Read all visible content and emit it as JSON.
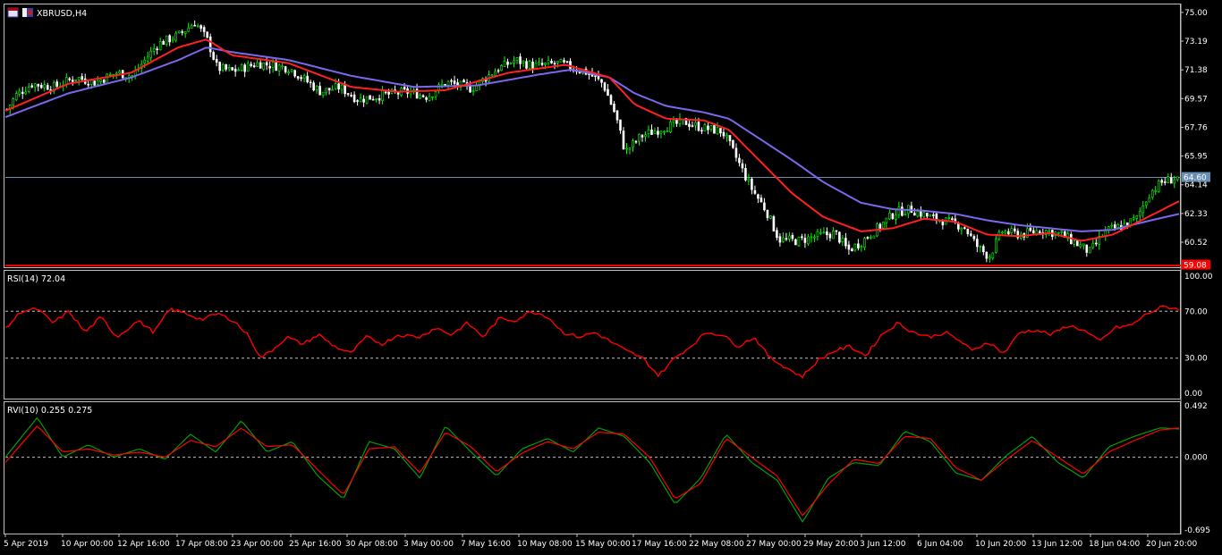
{
  "window": {
    "symbol_title": "XBRUSD,H4",
    "icon_names": [
      "chart-window-icon",
      "symbol-flag-icon"
    ]
  },
  "colors": {
    "background": "#000000",
    "frame": "#c0c0c0",
    "bull_candle": "#00ff00",
    "bear_candle": "#ffffff",
    "ma_fast": "#ff2020",
    "ma_slow": "#7b68ee",
    "bid_line": "#6a8fb5",
    "level_line": "#ff0000",
    "rsi_line": "#ff0000",
    "rvi_main": "#00a000",
    "rvi_signal": "#ff0000",
    "dashed_level": "#c0c0c0"
  },
  "chart_data": [
    {
      "type": "candlestick",
      "title": "XBRUSD,H4",
      "ylim": [
        59.0,
        75.5
      ],
      "y_ticks": [
        "75.00",
        "73.19",
        "71.38",
        "69.57",
        "67.76",
        "65.95",
        "64.14",
        "62.33",
        "60.52"
      ],
      "x_ticks": [
        "5 Apr 2019",
        "10 Apr 00:00",
        "12 Apr 16:00",
        "17 Apr 08:00",
        "23 Apr 00:00",
        "25 Apr 16:00",
        "30 Apr 08:00",
        "3 May 00:00",
        "7 May 16:00",
        "10 May 08:00",
        "15 May 00:00",
        "17 May 16:00",
        "22 May 08:00",
        "27 May 00:00",
        "29 May 20:00",
        "3 Jun 12:00",
        "6 Jun 04:00",
        "10 Jun 20:00",
        "13 Jun 12:00",
        "18 Jun 04:00",
        "20 Jun 20:00"
      ],
      "bid_label": "64.60",
      "bid_value": 64.6,
      "level_label": "59.08",
      "level_value": 59.08,
      "close_keypoints": [
        [
          0,
          68.9
        ],
        [
          3,
          69.8
        ],
        [
          8,
          70.5
        ],
        [
          15,
          70.3
        ],
        [
          22,
          70.9
        ],
        [
          28,
          70.6
        ],
        [
          35,
          71.2
        ],
        [
          40,
          71.0
        ],
        [
          48,
          73.0
        ],
        [
          55,
          73.6
        ],
        [
          60,
          74.4
        ],
        [
          64,
          73.2
        ],
        [
          67,
          71.5
        ],
        [
          72,
          71.3
        ],
        [
          80,
          71.8
        ],
        [
          90,
          71.5
        ],
        [
          100,
          70.0
        ],
        [
          106,
          70.3
        ],
        [
          112,
          69.5
        ],
        [
          120,
          69.8
        ],
        [
          128,
          70.0
        ],
        [
          134,
          69.7
        ],
        [
          140,
          70.6
        ],
        [
          148,
          70.2
        ],
        [
          156,
          71.4
        ],
        [
          162,
          72.0
        ],
        [
          168,
          71.6
        ],
        [
          176,
          71.8
        ],
        [
          185,
          71.2
        ],
        [
          190,
          70.5
        ],
        [
          194,
          68.5
        ],
        [
          197,
          66.2
        ],
        [
          202,
          67.2
        ],
        [
          210,
          67.8
        ],
        [
          216,
          68.1
        ],
        [
          222,
          67.7
        ],
        [
          228,
          67.5
        ],
        [
          232,
          66.0
        ],
        [
          237,
          64.0
        ],
        [
          242,
          62.5
        ],
        [
          246,
          60.7
        ],
        [
          252,
          60.6
        ],
        [
          258,
          60.9
        ],
        [
          264,
          61.1
        ],
        [
          268,
          60.0
        ],
        [
          272,
          60.5
        ],
        [
          278,
          61.5
        ],
        [
          283,
          62.4
        ],
        [
          288,
          62.6
        ],
        [
          294,
          62.1
        ],
        [
          300,
          61.8
        ],
        [
          305,
          61.5
        ],
        [
          309,
          60.3
        ],
        [
          313,
          59.6
        ],
        [
          317,
          61.2
        ],
        [
          323,
          61.0
        ],
        [
          330,
          61.3
        ],
        [
          336,
          61.0
        ],
        [
          342,
          60.3
        ],
        [
          345,
          59.9
        ],
        [
          350,
          61.2
        ],
        [
          356,
          61.6
        ],
        [
          360,
          62.0
        ],
        [
          364,
          63.6
        ],
        [
          368,
          64.3
        ],
        [
          373,
          64.6
        ]
      ],
      "ma_fast_keypoints": [
        [
          0,
          68.8
        ],
        [
          20,
          70.5
        ],
        [
          40,
          71.2
        ],
        [
          55,
          72.8
        ],
        [
          64,
          73.3
        ],
        [
          72,
          72.3
        ],
        [
          90,
          71.8
        ],
        [
          110,
          70.3
        ],
        [
          125,
          70.0
        ],
        [
          140,
          70.1
        ],
        [
          160,
          71.2
        ],
        [
          178,
          71.7
        ],
        [
          192,
          70.9
        ],
        [
          200,
          69.2
        ],
        [
          210,
          68.3
        ],
        [
          222,
          68.2
        ],
        [
          230,
          67.6
        ],
        [
          240,
          65.6
        ],
        [
          250,
          63.6
        ],
        [
          260,
          62.1
        ],
        [
          272,
          61.2
        ],
        [
          282,
          61.4
        ],
        [
          292,
          62.0
        ],
        [
          302,
          61.8
        ],
        [
          312,
          61.0
        ],
        [
          322,
          60.9
        ],
        [
          332,
          61.1
        ],
        [
          342,
          60.6
        ],
        [
          352,
          61.0
        ],
        [
          362,
          62.0
        ],
        [
          373,
          63.1
        ]
      ],
      "ma_slow_keypoints": [
        [
          0,
          68.4
        ],
        [
          20,
          69.9
        ],
        [
          40,
          70.9
        ],
        [
          55,
          72.0
        ],
        [
          64,
          72.8
        ],
        [
          72,
          72.5
        ],
        [
          90,
          72.0
        ],
        [
          110,
          71.0
        ],
        [
          130,
          70.3
        ],
        [
          150,
          70.4
        ],
        [
          170,
          71.1
        ],
        [
          180,
          71.4
        ],
        [
          192,
          70.9
        ],
        [
          200,
          69.9
        ],
        [
          210,
          69.1
        ],
        [
          222,
          68.7
        ],
        [
          230,
          68.3
        ],
        [
          240,
          67.0
        ],
        [
          250,
          65.7
        ],
        [
          260,
          64.3
        ],
        [
          272,
          63.0
        ],
        [
          282,
          62.6
        ],
        [
          292,
          62.5
        ],
        [
          302,
          62.3
        ],
        [
          312,
          61.9
        ],
        [
          322,
          61.6
        ],
        [
          332,
          61.4
        ],
        [
          342,
          61.2
        ],
        [
          352,
          61.3
        ],
        [
          362,
          61.8
        ],
        [
          373,
          62.3
        ]
      ]
    },
    {
      "type": "line",
      "title": "RSI(14) 72.04",
      "ylim": [
        0,
        100
      ],
      "y_ticks": [
        "100.00",
        "70.00",
        "30.00",
        "0.00"
      ],
      "levels": [
        70,
        30
      ],
      "keypoints": [
        [
          0,
          55
        ],
        [
          6,
          70
        ],
        [
          12,
          72
        ],
        [
          18,
          60
        ],
        [
          24,
          70
        ],
        [
          30,
          52
        ],
        [
          36,
          65
        ],
        [
          42,
          48
        ],
        [
          50,
          62
        ],
        [
          56,
          52
        ],
        [
          62,
          72
        ],
        [
          68,
          68
        ],
        [
          74,
          63
        ],
        [
          80,
          68
        ],
        [
          86,
          62
        ],
        [
          92,
          48
        ],
        [
          96,
          30
        ],
        [
          100,
          36
        ],
        [
          106,
          48
        ],
        [
          112,
          42
        ],
        [
          118,
          50
        ],
        [
          124,
          40
        ],
        [
          130,
          34
        ],
        [
          136,
          48
        ],
        [
          142,
          42
        ],
        [
          148,
          50
        ],
        [
          156,
          48
        ],
        [
          162,
          56
        ],
        [
          168,
          50
        ],
        [
          174,
          60
        ],
        [
          180,
          48
        ],
        [
          186,
          64
        ],
        [
          192,
          62
        ],
        [
          198,
          70
        ],
        [
          204,
          66
        ],
        [
          210,
          52
        ],
        [
          216,
          48
        ],
        [
          222,
          52
        ],
        [
          228,
          44
        ],
        [
          234,
          36
        ],
        [
          240,
          30
        ],
        [
          246,
          15
        ],
        [
          252,
          30
        ],
        [
          258,
          40
        ],
        [
          264,
          52
        ],
        [
          270,
          50
        ],
        [
          276,
          40
        ],
        [
          282,
          48
        ],
        [
          288,
          30
        ],
        [
          294,
          22
        ],
        [
          300,
          14
        ],
        [
          306,
          28
        ],
        [
          312,
          36
        ],
        [
          318,
          40
        ],
        [
          324,
          32
        ],
        [
          330,
          50
        ],
        [
          336,
          60
        ],
        [
          342,
          52
        ],
        [
          348,
          48
        ],
        [
          354,
          52
        ],
        [
          360,
          44
        ],
        [
          364,
          36
        ],
        [
          370,
          44
        ],
        [
          376,
          34
        ],
        [
          382,
          52
        ],
        [
          388,
          54
        ],
        [
          394,
          50
        ],
        [
          400,
          58
        ],
        [
          406,
          54
        ],
        [
          412,
          44
        ],
        [
          418,
          56
        ],
        [
          424,
          58
        ],
        [
          430,
          68
        ],
        [
          436,
          74
        ],
        [
          442,
          72
        ]
      ]
    },
    {
      "type": "line",
      "title": "RVI(10) 0.255 0.275",
      "ylim": [
        -0.695,
        0.492
      ],
      "y_ticks": [
        "0.492",
        "0.000",
        "-0.695"
      ],
      "levels": [
        0.0
      ],
      "main_keypoints": [
        [
          0,
          0.0
        ],
        [
          10,
          0.38
        ],
        [
          18,
          0.0
        ],
        [
          26,
          0.12
        ],
        [
          34,
          0.0
        ],
        [
          42,
          0.08
        ],
        [
          50,
          -0.02
        ],
        [
          58,
          0.22
        ],
        [
          66,
          0.05
        ],
        [
          74,
          0.35
        ],
        [
          82,
          0.05
        ],
        [
          90,
          0.15
        ],
        [
          98,
          -0.18
        ],
        [
          106,
          -0.4
        ],
        [
          114,
          0.15
        ],
        [
          122,
          0.08
        ],
        [
          130,
          -0.2
        ],
        [
          138,
          0.3
        ],
        [
          146,
          0.05
        ],
        [
          154,
          -0.18
        ],
        [
          162,
          0.08
        ],
        [
          170,
          0.18
        ],
        [
          178,
          0.05
        ],
        [
          186,
          0.28
        ],
        [
          194,
          0.2
        ],
        [
          202,
          -0.05
        ],
        [
          210,
          -0.45
        ],
        [
          218,
          -0.2
        ],
        [
          226,
          0.22
        ],
        [
          234,
          -0.05
        ],
        [
          242,
          -0.22
        ],
        [
          250,
          -0.62
        ],
        [
          258,
          -0.2
        ],
        [
          266,
          -0.05
        ],
        [
          274,
          -0.08
        ],
        [
          282,
          0.25
        ],
        [
          290,
          0.15
        ],
        [
          298,
          -0.15
        ],
        [
          306,
          -0.22
        ],
        [
          314,
          0.02
        ],
        [
          322,
          0.2
        ],
        [
          330,
          -0.05
        ],
        [
          338,
          -0.2
        ],
        [
          346,
          0.1
        ],
        [
          354,
          0.2
        ],
        [
          362,
          0.28
        ],
        [
          368,
          0.27
        ]
      ],
      "signal_keypoints": [
        [
          0,
          -0.05
        ],
        [
          10,
          0.3
        ],
        [
          18,
          0.05
        ],
        [
          26,
          0.08
        ],
        [
          34,
          0.02
        ],
        [
          42,
          0.05
        ],
        [
          50,
          0.0
        ],
        [
          58,
          0.16
        ],
        [
          66,
          0.1
        ],
        [
          74,
          0.28
        ],
        [
          82,
          0.1
        ],
        [
          90,
          0.12
        ],
        [
          98,
          -0.12
        ],
        [
          106,
          -0.36
        ],
        [
          114,
          0.08
        ],
        [
          122,
          0.1
        ],
        [
          130,
          -0.15
        ],
        [
          138,
          0.24
        ],
        [
          146,
          0.1
        ],
        [
          154,
          -0.14
        ],
        [
          162,
          0.04
        ],
        [
          170,
          0.15
        ],
        [
          178,
          0.08
        ],
        [
          186,
          0.24
        ],
        [
          194,
          0.22
        ],
        [
          202,
          0.0
        ],
        [
          210,
          -0.4
        ],
        [
          218,
          -0.25
        ],
        [
          226,
          0.18
        ],
        [
          234,
          0.0
        ],
        [
          242,
          -0.18
        ],
        [
          250,
          -0.56
        ],
        [
          258,
          -0.26
        ],
        [
          266,
          -0.02
        ],
        [
          274,
          -0.06
        ],
        [
          282,
          0.2
        ],
        [
          290,
          0.18
        ],
        [
          298,
          -0.1
        ],
        [
          306,
          -0.22
        ],
        [
          314,
          -0.02
        ],
        [
          322,
          0.16
        ],
        [
          330,
          0.0
        ],
        [
          338,
          -0.16
        ],
        [
          346,
          0.05
        ],
        [
          354,
          0.16
        ],
        [
          362,
          0.26
        ],
        [
          368,
          0.28
        ]
      ]
    }
  ]
}
